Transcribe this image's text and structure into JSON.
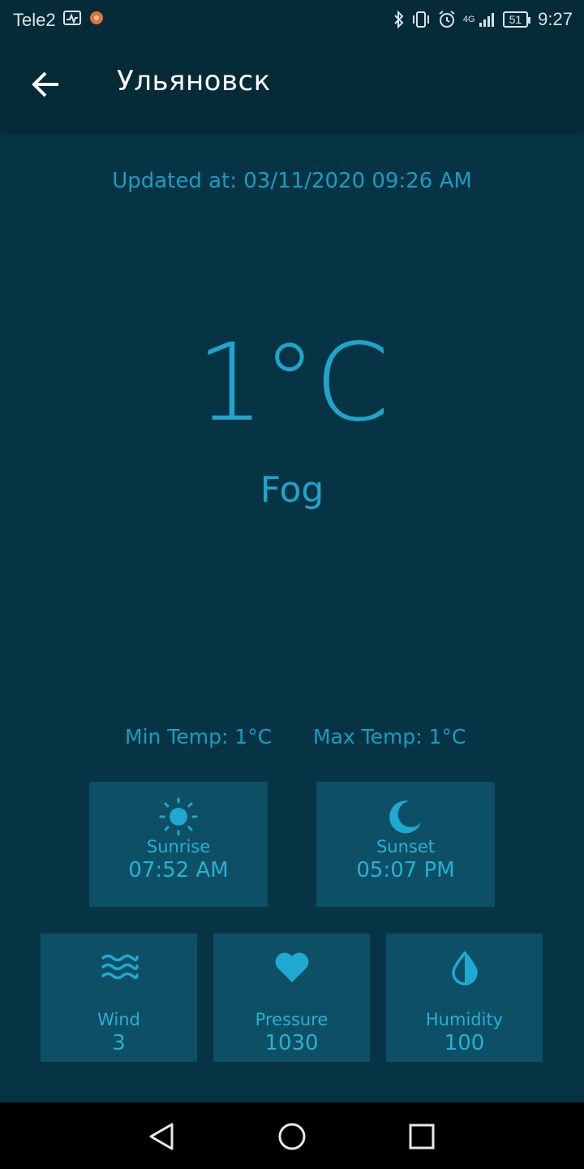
{
  "status_bar": {
    "carrier": "Tele2",
    "network": "4G",
    "battery": "51",
    "time": "9:27"
  },
  "header": {
    "city": "Ульяновск"
  },
  "weather": {
    "updated": "Updated at: 03/11/2020 09:26 AM",
    "temperature": "1°C",
    "condition": "Fog",
    "min_temp": "Min Temp: 1°C",
    "max_temp": "Max Temp: 1°C"
  },
  "cards": {
    "sunrise": {
      "label": "Sunrise",
      "value": "07:52 AM",
      "icon": "sun-icon"
    },
    "sunset": {
      "label": "Sunset",
      "value": "05:07 PM",
      "icon": "moon-icon"
    },
    "wind": {
      "label": "Wind",
      "value": "3",
      "icon": "waves-icon"
    },
    "pressure": {
      "label": "Pressure",
      "value": "1030",
      "icon": "heart-icon"
    },
    "humidity": {
      "label": "Humidity",
      "value": "100",
      "icon": "drop-icon"
    }
  },
  "colors": {
    "background": "#073444",
    "app_bar": "#062b38",
    "card": "#0d5066",
    "accent": "#1ea5cc"
  }
}
